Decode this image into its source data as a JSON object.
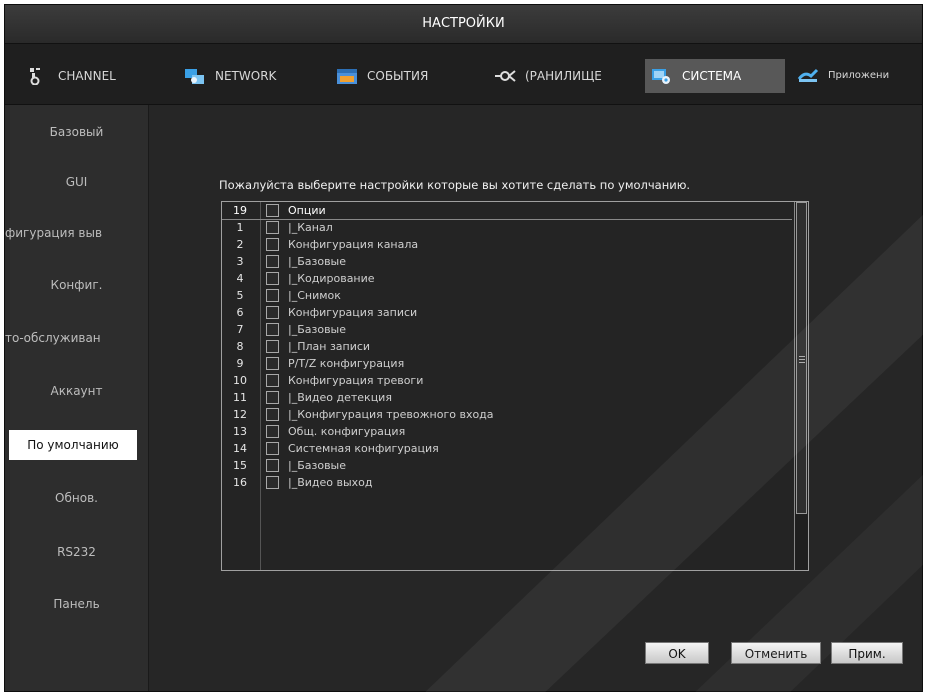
{
  "window": {
    "title": "НАСТРОЙКИ"
  },
  "tabs": [
    {
      "label": "CHANNEL",
      "icon": "channel-icon",
      "active": false
    },
    {
      "label": "NETWORK",
      "icon": "network-icon",
      "active": false
    },
    {
      "label": "СОБЫТИЯ",
      "icon": "events-icon",
      "active": false
    },
    {
      "label": "(РАНИЛИЩЕ",
      "icon": "storage-icon",
      "active": false
    },
    {
      "label": "СИСТЕМА",
      "icon": "system-icon",
      "active": true
    },
    {
      "label": "Приложени",
      "icon": "apps-icon",
      "active": false
    }
  ],
  "sidebar": {
    "items": [
      {
        "label": "Базовый"
      },
      {
        "label": "GUI"
      },
      {
        "label": "фигурация выв"
      },
      {
        "label": "Конфиг."
      },
      {
        "label": "то-обслуживан"
      },
      {
        "label": "Аккаунт"
      },
      {
        "label": "По умолчанию"
      },
      {
        "label": "Обнов."
      },
      {
        "label": "RS232"
      },
      {
        "label": "Панель"
      }
    ],
    "active_index": 6
  },
  "main": {
    "prompt": "Пожалуйста выберите настройки которые вы хотите сделать по умолчанию.",
    "list": {
      "header": {
        "num": "19",
        "label": "Опции"
      },
      "rows": [
        {
          "num": "1",
          "label": "|_Канал"
        },
        {
          "num": "2",
          "label": "Конфигурация канала"
        },
        {
          "num": "3",
          "label": "|_Базовые"
        },
        {
          "num": "4",
          "label": "|_Кодирование"
        },
        {
          "num": "5",
          "label": "|_Снимок"
        },
        {
          "num": "6",
          "label": "Конфигурация записи"
        },
        {
          "num": "7",
          "label": "|_Базовые"
        },
        {
          "num": "8",
          "label": "|_План записи"
        },
        {
          "num": "9",
          "label": "P/T/Z конфигурация"
        },
        {
          "num": "10",
          "label": "Конфигурация тревоги"
        },
        {
          "num": "11",
          "label": "|_Видео детекция"
        },
        {
          "num": "12",
          "label": "|_Конфигурация тревожного входа"
        },
        {
          "num": "13",
          "label": "Общ. конфигурация"
        },
        {
          "num": "14",
          "label": "Системная конфигурация"
        },
        {
          "num": "15",
          "label": "|_Базовые"
        },
        {
          "num": "16",
          "label": "|_Видео выход"
        }
      ]
    }
  },
  "buttons": {
    "ok": "OK",
    "cancel": "Отменить",
    "apply": "Прим."
  },
  "colors": {
    "background": "#262626",
    "active_tab": "#585858",
    "active_sidebar": "#ffffff",
    "text": "#d8d8d8"
  }
}
